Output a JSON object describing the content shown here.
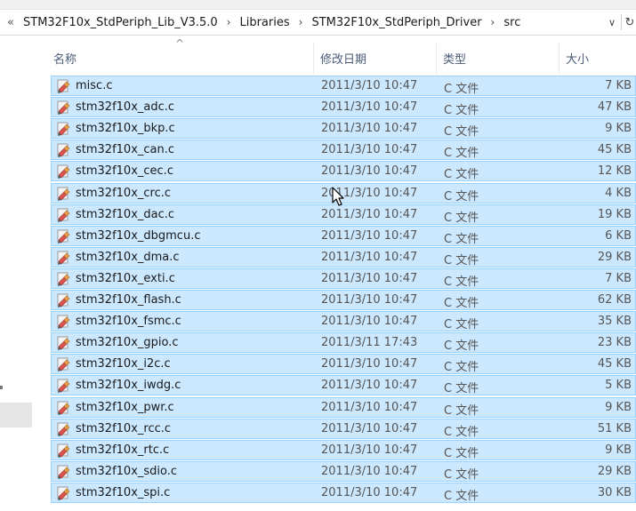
{
  "address_bar": {
    "overflow_glyph": "«",
    "segments": [
      "STM32F10x_StdPeriph_Lib_V3.5.0",
      "Libraries",
      "STM32F10x_StdPeriph_Driver",
      "src"
    ],
    "separator_glyph": "›",
    "dropdown_glyph": "∨",
    "refresh_glyph": "↻"
  },
  "columns": {
    "name": "名称",
    "date": "修改日期",
    "type": "类型",
    "size": "大小",
    "sort_indicator": "^"
  },
  "files": [
    {
      "name": "misc.c",
      "date": "2011/3/10 10:47",
      "type": "C 文件",
      "size": "7 KB"
    },
    {
      "name": "stm32f10x_adc.c",
      "date": "2011/3/10 10:47",
      "type": "C 文件",
      "size": "47 KB"
    },
    {
      "name": "stm32f10x_bkp.c",
      "date": "2011/3/10 10:47",
      "type": "C 文件",
      "size": "9 KB"
    },
    {
      "name": "stm32f10x_can.c",
      "date": "2011/3/10 10:47",
      "type": "C 文件",
      "size": "45 KB"
    },
    {
      "name": "stm32f10x_cec.c",
      "date": "2011/3/10 10:47",
      "type": "C 文件",
      "size": "12 KB"
    },
    {
      "name": "stm32f10x_crc.c",
      "date": "2011/3/10 10:47",
      "type": "C 文件",
      "size": "4 KB"
    },
    {
      "name": "stm32f10x_dac.c",
      "date": "2011/3/10 10:47",
      "type": "C 文件",
      "size": "19 KB"
    },
    {
      "name": "stm32f10x_dbgmcu.c",
      "date": "2011/3/10 10:47",
      "type": "C 文件",
      "size": "6 KB"
    },
    {
      "name": "stm32f10x_dma.c",
      "date": "2011/3/10 10:47",
      "type": "C 文件",
      "size": "29 KB"
    },
    {
      "name": "stm32f10x_exti.c",
      "date": "2011/3/10 10:47",
      "type": "C 文件",
      "size": "7 KB"
    },
    {
      "name": "stm32f10x_flash.c",
      "date": "2011/3/10 10:47",
      "type": "C 文件",
      "size": "62 KB"
    },
    {
      "name": "stm32f10x_fsmc.c",
      "date": "2011/3/10 10:47",
      "type": "C 文件",
      "size": "35 KB"
    },
    {
      "name": "stm32f10x_gpio.c",
      "date": "2011/3/11 17:43",
      "type": "C 文件",
      "size": "23 KB"
    },
    {
      "name": "stm32f10x_i2c.c",
      "date": "2011/3/10 10:47",
      "type": "C 文件",
      "size": "45 KB"
    },
    {
      "name": "stm32f10x_iwdg.c",
      "date": "2011/3/10 10:47",
      "type": "C 文件",
      "size": "5 KB"
    },
    {
      "name": "stm32f10x_pwr.c",
      "date": "2011/3/10 10:47",
      "type": "C 文件",
      "size": "9 KB"
    },
    {
      "name": "stm32f10x_rcc.c",
      "date": "2011/3/10 10:47",
      "type": "C 文件",
      "size": "51 KB"
    },
    {
      "name": "stm32f10x_rtc.c",
      "date": "2011/3/10 10:47",
      "type": "C 文件",
      "size": "9 KB"
    },
    {
      "name": "stm32f10x_sdio.c",
      "date": "2011/3/10 10:47",
      "type": "C 文件",
      "size": "29 KB"
    },
    {
      "name": "stm32f10x_spi.c",
      "date": "2011/3/10 10:47",
      "type": "C 文件",
      "size": "30 KB"
    }
  ],
  "file_icon": "c-source-file-icon",
  "colors": {
    "selection_fill": "#cce8ff",
    "selection_border": "#99d1ff",
    "header_text": "#4a5a78"
  }
}
